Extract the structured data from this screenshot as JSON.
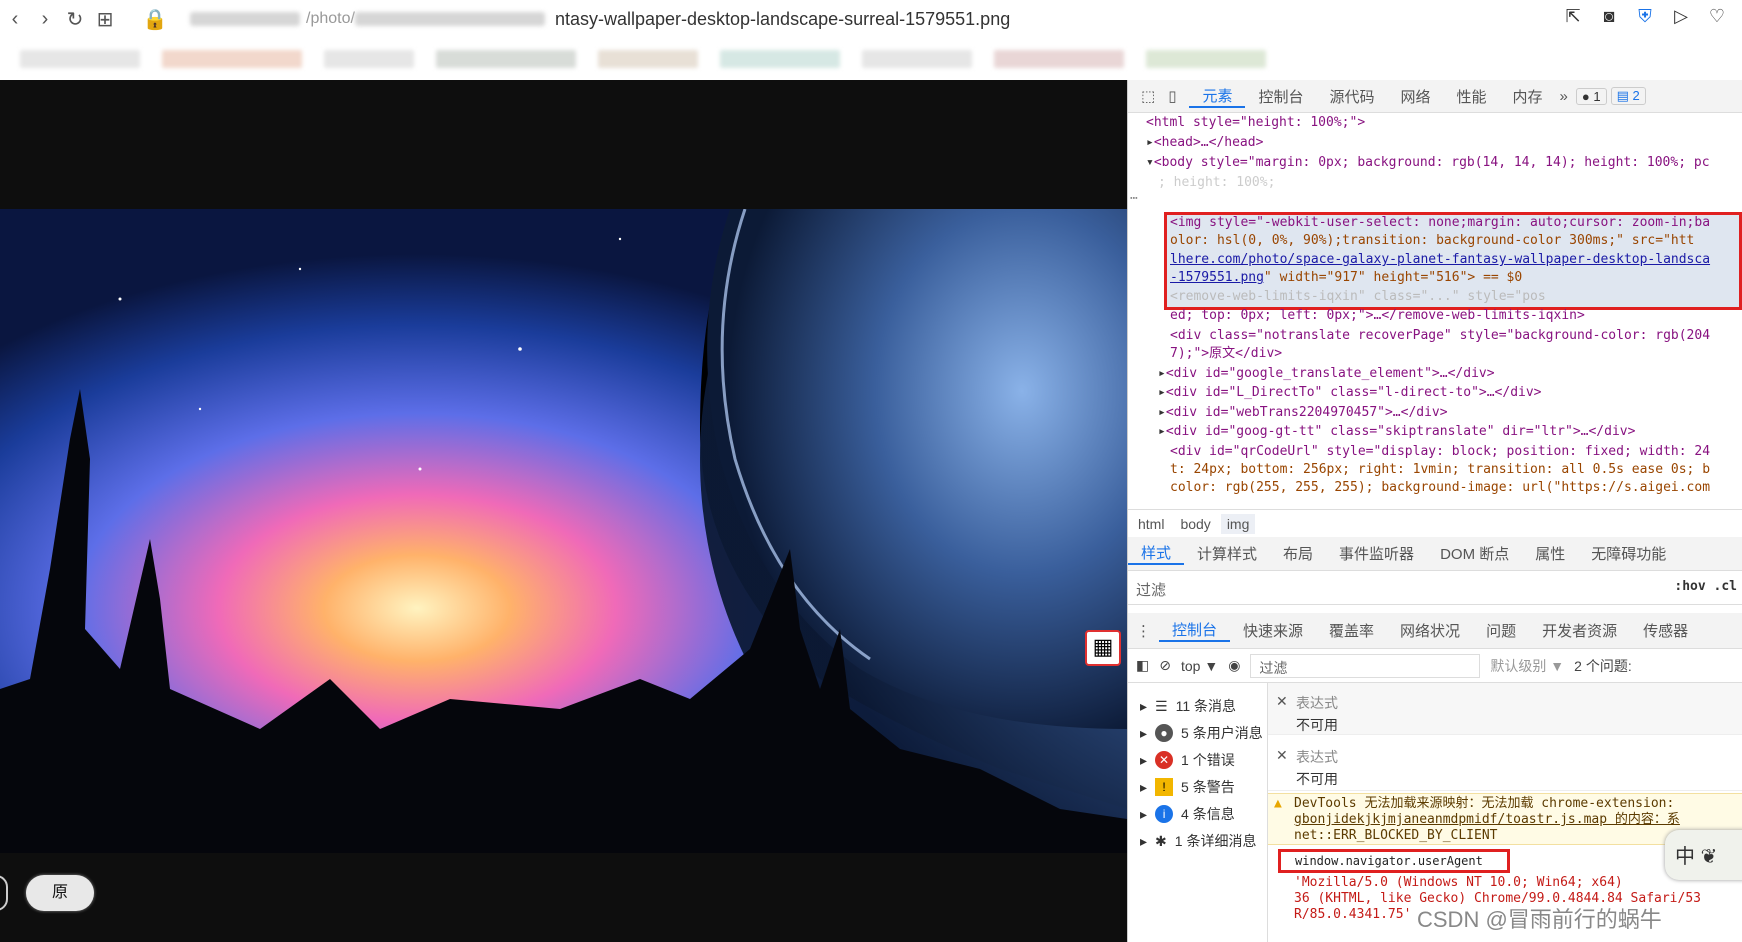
{
  "browser": {
    "url_visible": "ntasy-wallpaper-desktop-landscape-surreal-1579551.png",
    "url_prefix": "/photo/"
  },
  "viewer": {
    "orig_button": "原"
  },
  "devtools": {
    "top_tabs": [
      "元素",
      "控制台",
      "源代码",
      "网络",
      "性能",
      "内存"
    ],
    "more": "»",
    "error_count": "1",
    "message_count": "2",
    "dom": {
      "html_open": "<html style=\"height: 100%;\">",
      "head": "<head>…</head>",
      "body_open": "<body style=\"margin: 0px; background: rgb(14, 14, 14); height: 100%; pc",
      "body_cont": "     ; height: 100%; ",
      "img_l1": "<img style=\"-webkit-user-select: none;margin: auto;cursor: zoom-in;ba",
      "img_l2": "olor: hsl(0, 0%, 90%);transition: background-color 300ms;\" src=\"htt",
      "img_l3": "lhere.com/photo/space-galaxy-planet-fantasy-wallpaper-desktop-landsca",
      "img_l4_link": "-1579551.png",
      "img_l4_rest": "\" width=\"917\" height=\"516\"> == $0",
      "remove_l1": "<remove-web-limits-iqxin\" class=\"...\" style=\"pos",
      "remove_l2": "ed; top: 0px; left: 0px;\">…</remove-web-limits-iqxin>",
      "recover_l1": "<div class=\"notranslate recoverPage\" style=\"background-color: rgb(204",
      "recover_l2": "7);\">原文</div>",
      "gte": "<div id=\"google_translate_element\">…</div>",
      "ldir": "<div id=\"L_DirectTo\" class=\"l-direct-to\">…</div>",
      "webtrans": "<div id=\"webTrans2204970457\">…</div>",
      "goog": "<div id=\"goog-gt-tt\" class=\"skiptranslate\" dir=\"ltr\">…</div>",
      "qr_l1": "<div id=\"qrCodeUrl\" style=\"display: block; position: fixed; width: 24",
      "qr_l2": "t: 24px; bottom: 256px; right: 1vmin; transition: all 0.5s ease 0s; b",
      "qr_l3": "color: rgb(255, 255, 255); background-image: url(\"https://s.aigei.com"
    },
    "breadcrumbs": [
      "html",
      "body",
      "img"
    ],
    "styles_tabs": [
      "样式",
      "计算样式",
      "布局",
      "事件监听器",
      "DOM 断点",
      "属性",
      "无障碍功能"
    ],
    "filter_placeholder": "过滤",
    "hov": ":hov  .cl",
    "drawer_tabs": [
      "控制台",
      "快速来源",
      "覆盖率",
      "网络状况",
      "问题",
      "开发者资源",
      "传感器"
    ],
    "console_toolbar": {
      "context": "top ▼",
      "filter": "过滤",
      "levels": "默认级别 ▼",
      "issues": "2 个问题:"
    },
    "sidebar": [
      {
        "label": "11 条消息",
        "icon": "list-icon"
      },
      {
        "label": "5 条用户消息",
        "icon": "user-icon"
      },
      {
        "label": "1 个错误",
        "icon": "error-icon"
      },
      {
        "label": "5 条警告",
        "icon": "warning-icon"
      },
      {
        "label": "4 条信息",
        "icon": "info-icon"
      },
      {
        "label": "1 条详细消息",
        "icon": "bug-icon"
      }
    ],
    "console": {
      "expr1_label": "表达式",
      "expr1_value": "不可用",
      "expr2_label": "表达式",
      "expr2_value": "不可用",
      "warn_l1": "DevTools 无法加载来源映射：无法加载 chrome-extension:",
      "warn_l2": "gbonjidekjkjmjaneanmdpmidf/toastr.js.map 的内容：系",
      "warn_l3": "net::ERR_BLOCKED_BY_CLIENT",
      "input": "window.navigator.userAgent",
      "result_l1": "'Mozilla/5.0 (Windows NT 10.0; Win64; x64)",
      "result_l2": "36 (KHTML, like Gecko) Chrome/99.0.4844.84 Safari/53",
      "result_l3": "R/85.0.4341.75'"
    }
  },
  "ime": "中 ❦",
  "watermark": "CSDN @冒雨前行的蜗牛"
}
